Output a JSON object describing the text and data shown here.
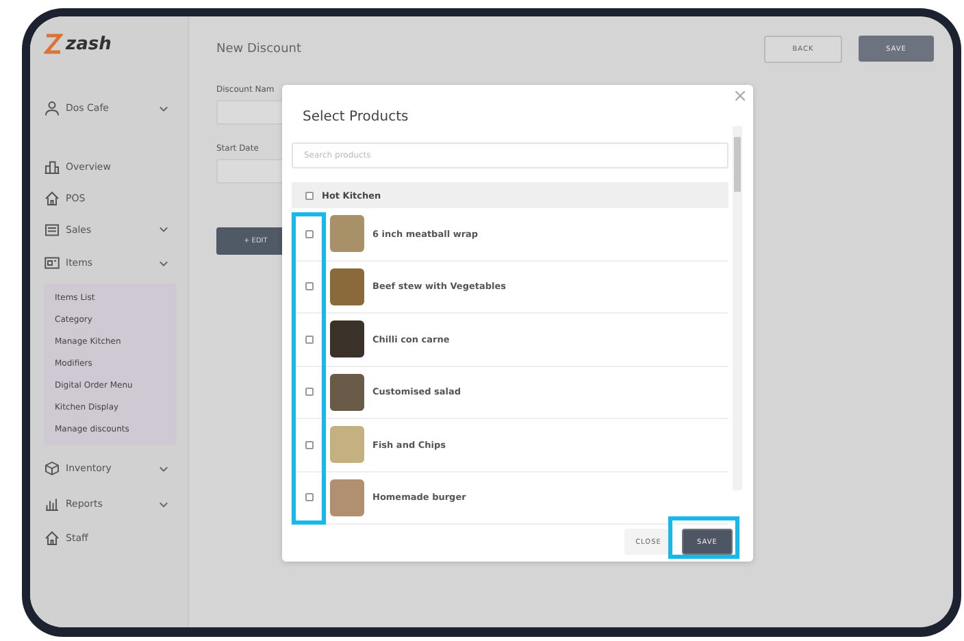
{
  "sidebar": {
    "logo": "zash",
    "account": {
      "label": "Dos Cafe",
      "expanded": false
    },
    "items": [
      {
        "label": "Overview",
        "kind": "building"
      },
      {
        "label": "POS",
        "kind": "home"
      },
      {
        "label": "Sales",
        "kind": "receipt",
        "has_submenu": true
      },
      {
        "label": "Items",
        "kind": "grid",
        "has_submenu": true,
        "children": [
          {
            "label": "Items List"
          },
          {
            "label": "Category"
          },
          {
            "label": "Manage Kitchen"
          },
          {
            "label": "Modifiers"
          },
          {
            "label": "Digital Order Menu"
          },
          {
            "label": "Kitchen Display"
          },
          {
            "label": "Manage discounts"
          }
        ]
      },
      {
        "label": "Inventory",
        "kind": "box",
        "has_submenu": true
      },
      {
        "label": "Reports",
        "kind": "chart",
        "has_submenu": true
      },
      {
        "label": "Staff",
        "kind": "home"
      }
    ]
  },
  "page": {
    "title": "New Discount",
    "buttons": [
      {
        "label": "BACK",
        "kind": "outline"
      },
      {
        "label": "SAVE",
        "kind": "primary"
      }
    ],
    "fields": [
      {
        "label": "Discount Nam"
      },
      {
        "label": "Start Date"
      }
    ],
    "edit_button": "+ EDIT"
  },
  "modal": {
    "title": "Select Products",
    "close": "×",
    "search": {
      "placeholder": "Search products"
    },
    "group": {
      "label": "Hot Kitchen",
      "checked": false
    },
    "products": [
      {
        "name": "6 inch meatball wrap",
        "checked": false
      },
      {
        "name": "Beef stew with Vegetables",
        "checked": false
      },
      {
        "name": "Chilli con carne",
        "checked": false
      },
      {
        "name": "Customised salad",
        "checked": false
      },
      {
        "name": "Fish and Chips",
        "checked": false
      },
      {
        "name": "Homemade burger",
        "checked": false
      }
    ],
    "buttons": [
      {
        "label": "CLOSE",
        "kind": "outline"
      },
      {
        "label": "SAVE",
        "kind": "primary"
      }
    ]
  }
}
